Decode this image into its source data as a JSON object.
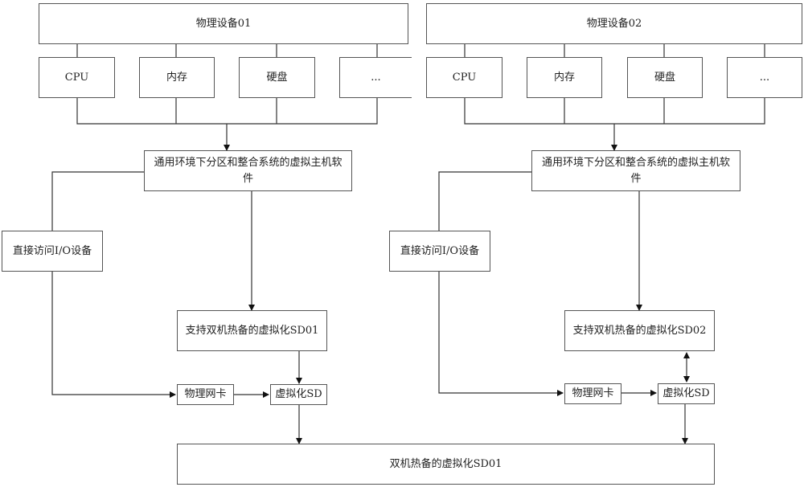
{
  "diagram": {
    "left": {
      "device": "物理设备01",
      "components": [
        "CPU",
        "内存",
        "硬盘",
        "..."
      ],
      "host_software": "通用环境下分区和整合系统的虚拟主机软件",
      "direct_io": "直接访问I/O设备",
      "hot_standby_sd": "支持双机热备的虚拟化SD01",
      "nic": "物理网卡",
      "virtual_sd": "虚拟化SD"
    },
    "right": {
      "device": "物理设备02",
      "components": [
        "CPU",
        "内存",
        "硬盘",
        "..."
      ],
      "host_software": "通用环境下分区和整合系统的虚拟主机软件",
      "direct_io": "直接访问I/O设备",
      "hot_standby_sd": "支持双机热备的虚拟化SD02",
      "nic": "物理网卡",
      "virtual_sd": "虚拟化SD"
    },
    "shared_sd": "双机热备的虚拟化SD01"
  }
}
